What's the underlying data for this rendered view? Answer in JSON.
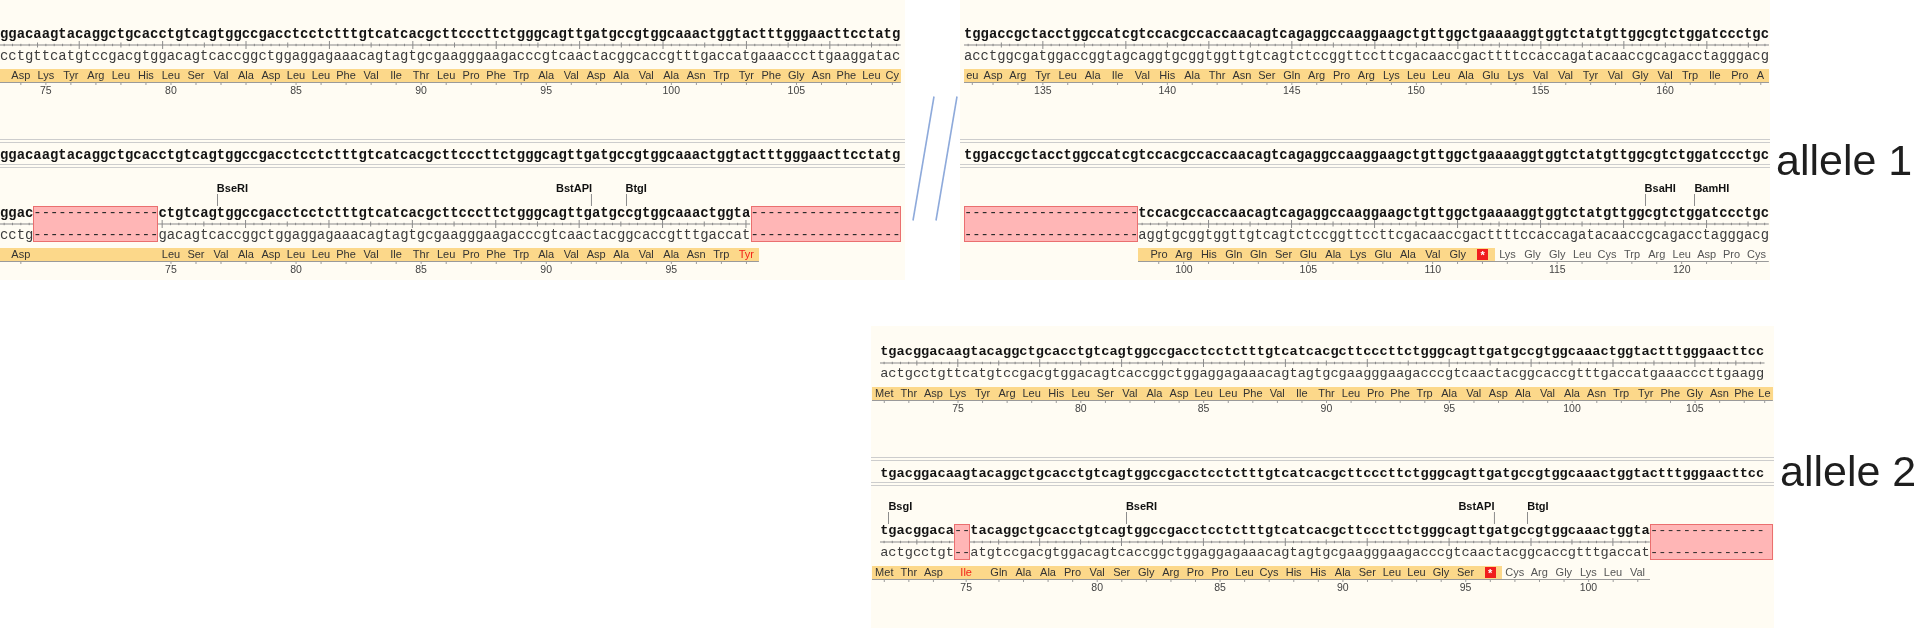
{
  "panels": [
    {
      "map": {
        "segments": [
          {
            "kind": "bases",
            "top": "ggacaagtacaggctgcacctgtcagtggccgacctcctctttgtcatcacgcttcccttctgggcagttgatgccgtggcaaactggtactttgggaacttcctatg",
            "bottom": "cctgttcatgtccgacgtggacagtcaccggctggaggagaaacagtagtgcgaagggaagacccgtcaactacggcaccgtttgaccatgaaacccttgaaggatac"
          }
        ],
        "translation": [
          {
            "label": "Asp",
            "kind": "aa"
          },
          {
            "label": "Lys",
            "kind": "aa",
            "number": "75"
          },
          {
            "label": "Tyr",
            "kind": "aa"
          },
          {
            "label": "Arg",
            "kind": "aa"
          },
          {
            "label": "Leu",
            "kind": "aa"
          },
          {
            "label": "His",
            "kind": "aa"
          },
          {
            "label": "Leu",
            "kind": "aa",
            "number": "80"
          },
          {
            "label": "Ser",
            "kind": "aa"
          },
          {
            "label": "Val",
            "kind": "aa"
          },
          {
            "label": "Ala",
            "kind": "aa"
          },
          {
            "label": "Asp",
            "kind": "aa"
          },
          {
            "label": "Leu",
            "kind": "aa",
            "number": "85"
          },
          {
            "label": "Leu",
            "kind": "aa"
          },
          {
            "label": "Phe",
            "kind": "aa"
          },
          {
            "label": "Val",
            "kind": "aa"
          },
          {
            "label": "Ile",
            "kind": "aa"
          },
          {
            "label": "Thr",
            "kind": "aa",
            "number": "90"
          },
          {
            "label": "Leu",
            "kind": "aa"
          },
          {
            "label": "Pro",
            "kind": "aa"
          },
          {
            "label": "Phe",
            "kind": "aa"
          },
          {
            "label": "Trp",
            "kind": "aa"
          },
          {
            "label": "Ala",
            "kind": "aa",
            "number": "95"
          },
          {
            "label": "Val",
            "kind": "aa"
          },
          {
            "label": "Asp",
            "kind": "aa"
          },
          {
            "label": "Ala",
            "kind": "aa"
          },
          {
            "label": "Val",
            "kind": "aa"
          },
          {
            "label": "Ala",
            "kind": "aa",
            "number": "100"
          },
          {
            "label": "Asn",
            "kind": "aa"
          },
          {
            "label": "Trp",
            "kind": "aa"
          },
          {
            "label": "Tyr",
            "kind": "aa"
          },
          {
            "label": "Phe",
            "kind": "aa"
          },
          {
            "label": "Gly",
            "kind": "aa",
            "number": "105"
          },
          {
            "label": "Asn",
            "kind": "aa"
          },
          {
            "label": "Phe",
            "kind": "aa"
          },
          {
            "label": "Leu",
            "kind": "aa"
          },
          {
            "label": "Cy",
            "kind": "aa"
          }
        ]
      },
      "alignment": {
        "reference": "ggacaagtacaggctgcacctgtcagtggccgacctcctctttgtcatcacgcttcccttctgggcagttgatgccgtggcaaactggtactttgggaacttcctatg",
        "sites": [
          "BseRI",
          "BstAPI",
          "BtgI"
        ],
        "segments": [
          {
            "kind": "bases",
            "top": "ggac",
            "bottom": "cctg"
          },
          {
            "kind": "gap",
            "top": "---------------",
            "bottom": "---------------"
          },
          {
            "kind": "bases",
            "top": "ctgtcagtggccgacctcctctttgtcatcacgcttcccttctgggcagttgatgccgtggcaaactggta",
            "bottom": "gacagtcaccggctggaggagaaacagtagtgcgaagggaagacccgtcaactacggcaccgtttgaccat"
          },
          {
            "kind": "gap",
            "top": "------------------",
            "bottom": "------------------"
          }
        ],
        "translation": [
          {
            "label": "Asp",
            "kind": "aa"
          },
          {
            "label": "Leu",
            "kind": "aa",
            "number": "75"
          },
          {
            "label": "Ser",
            "kind": "aa"
          },
          {
            "label": "Val",
            "kind": "aa"
          },
          {
            "label": "Ala",
            "kind": "aa"
          },
          {
            "label": "Asp",
            "kind": "aa"
          },
          {
            "label": "Leu",
            "kind": "aa",
            "number": "80"
          },
          {
            "label": "Leu",
            "kind": "aa"
          },
          {
            "label": "Phe",
            "kind": "aa"
          },
          {
            "label": "Val",
            "kind": "aa"
          },
          {
            "label": "Ile",
            "kind": "aa"
          },
          {
            "label": "Thr",
            "kind": "aa",
            "number": "85"
          },
          {
            "label": "Leu",
            "kind": "aa"
          },
          {
            "label": "Pro",
            "kind": "aa"
          },
          {
            "label": "Phe",
            "kind": "aa"
          },
          {
            "label": "Trp",
            "kind": "aa"
          },
          {
            "label": "Ala",
            "kind": "aa",
            "number": "90"
          },
          {
            "label": "Val",
            "kind": "aa"
          },
          {
            "label": "Asp",
            "kind": "aa"
          },
          {
            "label": "Ala",
            "kind": "aa"
          },
          {
            "label": "Val",
            "kind": "aa"
          },
          {
            "label": "Ala",
            "kind": "aa",
            "number": "95"
          },
          {
            "label": "Asn",
            "kind": "aa"
          },
          {
            "label": "Trp",
            "kind": "aa"
          },
          {
            "label": "Tyr",
            "kind": "changed"
          }
        ]
      }
    },
    {
      "map": {
        "segments": [
          {
            "kind": "bases",
            "top": "tggaccgctacctggccatcgtccacgccaccaacagtcagaggccaaggaagctgttggctgaaaaggtggtctatgttggcgtctggatccctgc",
            "bottom": "acctggcgatggaccggtagcaggtgcggtggttgtcagtctccggttccttcgacaaccgacttttccaccagatacaaccgcagacctagggacg"
          }
        ],
        "translation": [
          {
            "label": "eu",
            "kind": "aa"
          },
          {
            "label": "Asp",
            "kind": "aa"
          },
          {
            "label": "Arg",
            "kind": "aa"
          },
          {
            "label": "Tyr",
            "kind": "aa",
            "number": "135"
          },
          {
            "label": "Leu",
            "kind": "aa"
          },
          {
            "label": "Ala",
            "kind": "aa"
          },
          {
            "label": "Ile",
            "kind": "aa"
          },
          {
            "label": "Val",
            "kind": "aa"
          },
          {
            "label": "His",
            "kind": "aa",
            "number": "140"
          },
          {
            "label": "Ala",
            "kind": "aa"
          },
          {
            "label": "Thr",
            "kind": "aa"
          },
          {
            "label": "Asn",
            "kind": "aa"
          },
          {
            "label": "Ser",
            "kind": "aa"
          },
          {
            "label": "Gln",
            "kind": "aa",
            "number": "145"
          },
          {
            "label": "Arg",
            "kind": "aa"
          },
          {
            "label": "Pro",
            "kind": "aa"
          },
          {
            "label": "Arg",
            "kind": "aa"
          },
          {
            "label": "Lys",
            "kind": "aa"
          },
          {
            "label": "Leu",
            "kind": "aa",
            "number": "150"
          },
          {
            "label": "Leu",
            "kind": "aa"
          },
          {
            "label": "Ala",
            "kind": "aa"
          },
          {
            "label": "Glu",
            "kind": "aa"
          },
          {
            "label": "Lys",
            "kind": "aa"
          },
          {
            "label": "Val",
            "kind": "aa",
            "number": "155"
          },
          {
            "label": "Val",
            "kind": "aa"
          },
          {
            "label": "Tyr",
            "kind": "aa"
          },
          {
            "label": "Val",
            "kind": "aa"
          },
          {
            "label": "Gly",
            "kind": "aa"
          },
          {
            "label": "Val",
            "kind": "aa",
            "number": "160"
          },
          {
            "label": "Trp",
            "kind": "aa"
          },
          {
            "label": "Ile",
            "kind": "aa"
          },
          {
            "label": "Pro",
            "kind": "aa"
          },
          {
            "label": "A",
            "kind": "aa"
          }
        ]
      },
      "alignment": {
        "reference": "tggaccgctacctggccatcgtccacgccaccaacagtcagaggccaaggaagctgttggctgaaaaggtggtctatgttggcgtctggatccctgc",
        "sites": [
          "BsaHI",
          "BamHI"
        ],
        "segments": [
          {
            "kind": "gap",
            "top": "---------------------",
            "bottom": "---------------------"
          },
          {
            "kind": "bases",
            "top": "tccacgccaccaacagtcagaggccaaggaagctgttggctgaaaaggtggtctatgttggcgtctggatccctgc",
            "bottom": "aggtgcggtggttgtcagtctccggttccttcgacaaccgacttttccaccagatacaaccgcagacctagggacg"
          }
        ],
        "translation": [
          {
            "label": "Pro",
            "kind": "aa"
          },
          {
            "label": "Arg",
            "kind": "aa",
            "number": "100"
          },
          {
            "label": "His",
            "kind": "aa"
          },
          {
            "label": "Gln",
            "kind": "aa"
          },
          {
            "label": "Gln",
            "kind": "aa"
          },
          {
            "label": "Ser",
            "kind": "aa"
          },
          {
            "label": "Glu",
            "kind": "aa",
            "number": "105"
          },
          {
            "label": "Ala",
            "kind": "aa"
          },
          {
            "label": "Lys",
            "kind": "aa"
          },
          {
            "label": "Glu",
            "kind": "aa"
          },
          {
            "label": "Ala",
            "kind": "aa"
          },
          {
            "label": "Val",
            "kind": "aa",
            "number": "110"
          },
          {
            "label": "Gly",
            "kind": "aa"
          },
          {
            "label": "*",
            "kind": "stop"
          },
          {
            "label": "Lys",
            "kind": "readthrough"
          },
          {
            "label": "Gly",
            "kind": "readthrough"
          },
          {
            "label": "Gly",
            "kind": "readthrough",
            "number": "115"
          },
          {
            "label": "Leu",
            "kind": "readthrough"
          },
          {
            "label": "Cys",
            "kind": "readthrough"
          },
          {
            "label": "Trp",
            "kind": "readthrough"
          },
          {
            "label": "Arg",
            "kind": "readthrough"
          },
          {
            "label": "Leu",
            "kind": "readthrough",
            "number": "120"
          },
          {
            "label": "Asp",
            "kind": "readthrough"
          },
          {
            "label": "Pro",
            "kind": "readthrough"
          },
          {
            "label": "Cys",
            "kind": "readthrough"
          }
        ]
      }
    },
    {
      "map": {
        "segments": [
          {
            "kind": "bases",
            "top": "tgacggacaagtacaggctgcacctgtcagtggccgacctcctctttgtcatcacgcttcccttctgggcagttgatgccgtggcaaactggtactttgggaacttcc",
            "bottom": "actgcctgttcatgtccgacgtggacagtcaccggctggaggagaaacagtagtgcgaagggaagacccgtcaactacggcaccgtttgaccatgaaacccttgaagg"
          }
        ],
        "translation": [
          {
            "label": "Met",
            "kind": "aa"
          },
          {
            "label": "Thr",
            "kind": "aa"
          },
          {
            "label": "Asp",
            "kind": "aa"
          },
          {
            "label": "Lys",
            "kind": "aa",
            "number": "75"
          },
          {
            "label": "Tyr",
            "kind": "aa"
          },
          {
            "label": "Arg",
            "kind": "aa"
          },
          {
            "label": "Leu",
            "kind": "aa"
          },
          {
            "label": "His",
            "kind": "aa"
          },
          {
            "label": "Leu",
            "kind": "aa",
            "number": "80"
          },
          {
            "label": "Ser",
            "kind": "aa"
          },
          {
            "label": "Val",
            "kind": "aa"
          },
          {
            "label": "Ala",
            "kind": "aa"
          },
          {
            "label": "Asp",
            "kind": "aa"
          },
          {
            "label": "Leu",
            "kind": "aa",
            "number": "85"
          },
          {
            "label": "Leu",
            "kind": "aa"
          },
          {
            "label": "Phe",
            "kind": "aa"
          },
          {
            "label": "Val",
            "kind": "aa"
          },
          {
            "label": "Ile",
            "kind": "aa"
          },
          {
            "label": "Thr",
            "kind": "aa",
            "number": "90"
          },
          {
            "label": "Leu",
            "kind": "aa"
          },
          {
            "label": "Pro",
            "kind": "aa"
          },
          {
            "label": "Phe",
            "kind": "aa"
          },
          {
            "label": "Trp",
            "kind": "aa"
          },
          {
            "label": "Ala",
            "kind": "aa",
            "number": "95"
          },
          {
            "label": "Val",
            "kind": "aa"
          },
          {
            "label": "Asp",
            "kind": "aa"
          },
          {
            "label": "Ala",
            "kind": "aa"
          },
          {
            "label": "Val",
            "kind": "aa"
          },
          {
            "label": "Ala",
            "kind": "aa",
            "number": "100"
          },
          {
            "label": "Asn",
            "kind": "aa"
          },
          {
            "label": "Trp",
            "kind": "aa"
          },
          {
            "label": "Tyr",
            "kind": "aa"
          },
          {
            "label": "Phe",
            "kind": "aa"
          },
          {
            "label": "Gly",
            "kind": "aa",
            "number": "105"
          },
          {
            "label": "Asn",
            "kind": "aa"
          },
          {
            "label": "Phe",
            "kind": "aa"
          },
          {
            "label": "Le",
            "kind": "aa"
          }
        ]
      },
      "alignment": {
        "reference": "tgacggacaagtacaggctgcacctgtcagtggccgacctcctctttgtcatcacgcttcccttctgggcagttgatgccgtggcaaactggtactttgggaacttcc",
        "sites": [
          "BsgI",
          "BseRI",
          "BstAPI",
          "BtgI"
        ],
        "segments": [
          {
            "kind": "bases",
            "top": "tgacggaca",
            "bottom": "actgcctgt"
          },
          {
            "kind": "gap",
            "top": "--",
            "bottom": "--"
          },
          {
            "kind": "bases",
            "top": "tacaggctgcacctgtcagtggccgacctcctctttgtcatcacgcttcccttctgggcagttgatgccgtggcaaactggta",
            "bottom": "atgtccgacgtggacagtcaccggctggaggagaaacagtagtgcgaagggaagacccgtcaactacggcaccgtttgaccat"
          },
          {
            "kind": "gap",
            "top": "--------------",
            "bottom": "--------------"
          }
        ],
        "translation": [
          {
            "label": "Met",
            "kind": "aa"
          },
          {
            "label": "Thr",
            "kind": "aa"
          },
          {
            "label": "Asp",
            "kind": "aa"
          },
          {
            "label": "Ile",
            "kind": "changed",
            "number": "75"
          },
          {
            "label": "Gln",
            "kind": "aa"
          },
          {
            "label": "Ala",
            "kind": "aa"
          },
          {
            "label": "Ala",
            "kind": "aa"
          },
          {
            "label": "Pro",
            "kind": "aa"
          },
          {
            "label": "Val",
            "kind": "aa",
            "number": "80"
          },
          {
            "label": "Ser",
            "kind": "aa"
          },
          {
            "label": "Gly",
            "kind": "aa"
          },
          {
            "label": "Arg",
            "kind": "aa"
          },
          {
            "label": "Pro",
            "kind": "aa"
          },
          {
            "label": "Pro",
            "kind": "aa",
            "number": "85"
          },
          {
            "label": "Leu",
            "kind": "aa"
          },
          {
            "label": "Cys",
            "kind": "aa"
          },
          {
            "label": "His",
            "kind": "aa"
          },
          {
            "label": "His",
            "kind": "aa"
          },
          {
            "label": "Ala",
            "kind": "aa",
            "number": "90"
          },
          {
            "label": "Ser",
            "kind": "aa"
          },
          {
            "label": "Leu",
            "kind": "aa"
          },
          {
            "label": "Leu",
            "kind": "aa"
          },
          {
            "label": "Gly",
            "kind": "aa"
          },
          {
            "label": "Ser",
            "kind": "aa",
            "number": "95"
          },
          {
            "label": "*",
            "kind": "stop"
          },
          {
            "label": "Cys",
            "kind": "readthrough"
          },
          {
            "label": "Arg",
            "kind": "readthrough"
          },
          {
            "label": "Gly",
            "kind": "readthrough"
          },
          {
            "label": "Lys",
            "kind": "readthrough",
            "number": "100"
          },
          {
            "label": "Leu",
            "kind": "readthrough"
          },
          {
            "label": "Val",
            "kind": "readthrough"
          }
        ]
      }
    }
  ],
  "allele_labels": [
    "allele 1",
    "allele 2"
  ]
}
